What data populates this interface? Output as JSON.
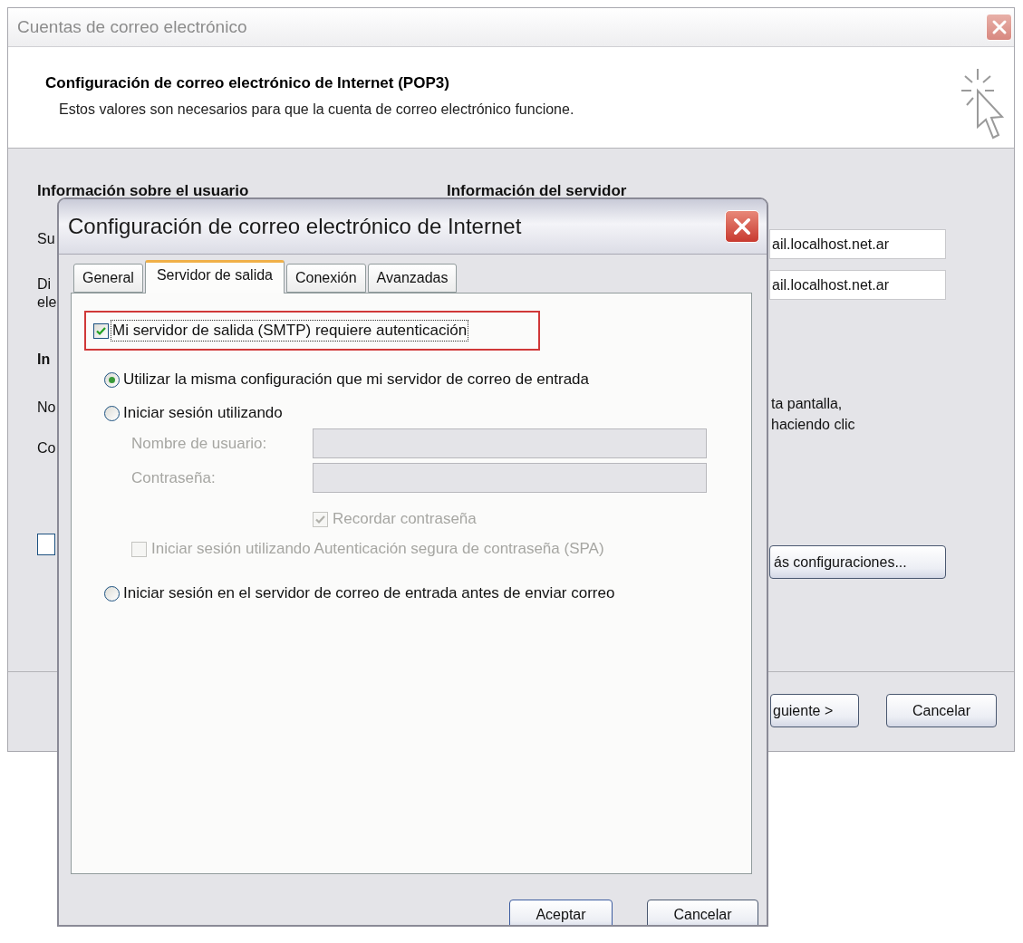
{
  "back_window": {
    "title": "Cuentas de correo electrónico",
    "header": {
      "title": "Configuración de correo electrónico de Internet (POP3)",
      "subtitle": "Estos valores son necesarios para que la cuenta de correo electrónico funcione."
    },
    "headings": [
      "Información sobre el usuario",
      "Información del servidor"
    ],
    "left_fragments": [
      {
        "kind": "label",
        "text": "Su"
      },
      {
        "kind": "label",
        "text": "Di"
      },
      {
        "kind": "label",
        "text": "ele"
      },
      {
        "kind": "heading",
        "text": "In"
      },
      {
        "kind": "label",
        "text": "No"
      },
      {
        "kind": "label",
        "text": "Co"
      }
    ],
    "checkbox": {
      "checked": false
    },
    "server_fields": [
      {
        "value": "ail.localhost.net.ar"
      },
      {
        "value": "ail.localhost.net.ar"
      }
    ],
    "note_lines": [
      "ta pantalla,",
      "haciendo clic"
    ],
    "more_settings_button": "ás configuraciones...",
    "buttons": [
      "guiente >",
      "Cancelar"
    ]
  },
  "dialog": {
    "title": "Configuración de correo electrónico de Internet",
    "tabs": [
      {
        "label": "General",
        "selected": false
      },
      {
        "label": "Servidor de salida",
        "selected": true
      },
      {
        "label": "Conexión",
        "selected": false
      },
      {
        "label": "Avanzadas",
        "selected": false
      }
    ],
    "require_auth": {
      "label": "Mi servidor de salida (SMTP) requiere autenticación",
      "checked": true
    },
    "login_options": [
      {
        "label": "Utilizar la misma configuración que mi servidor de correo de entrada",
        "selected": true
      },
      {
        "label": "Iniciar sesión utilizando",
        "selected": false
      },
      {
        "label": "Iniciar sesión en el servidor de correo de entrada antes de enviar correo",
        "selected": false
      }
    ],
    "credentials": [
      {
        "label": "Nombre de usuario:",
        "disabled": true
      },
      {
        "label": "Contraseña:",
        "disabled": true
      }
    ],
    "remember_password": {
      "label": "Recordar contraseña",
      "checked": true,
      "disabled": true
    },
    "spa": {
      "label": "Iniciar sesión utilizando Autenticación segura de contraseña (SPA)",
      "checked": false,
      "disabled": true
    },
    "buttons": [
      {
        "label": "Aceptar",
        "kind": "default"
      },
      {
        "label": "Cancelar",
        "kind": "normal"
      }
    ]
  }
}
